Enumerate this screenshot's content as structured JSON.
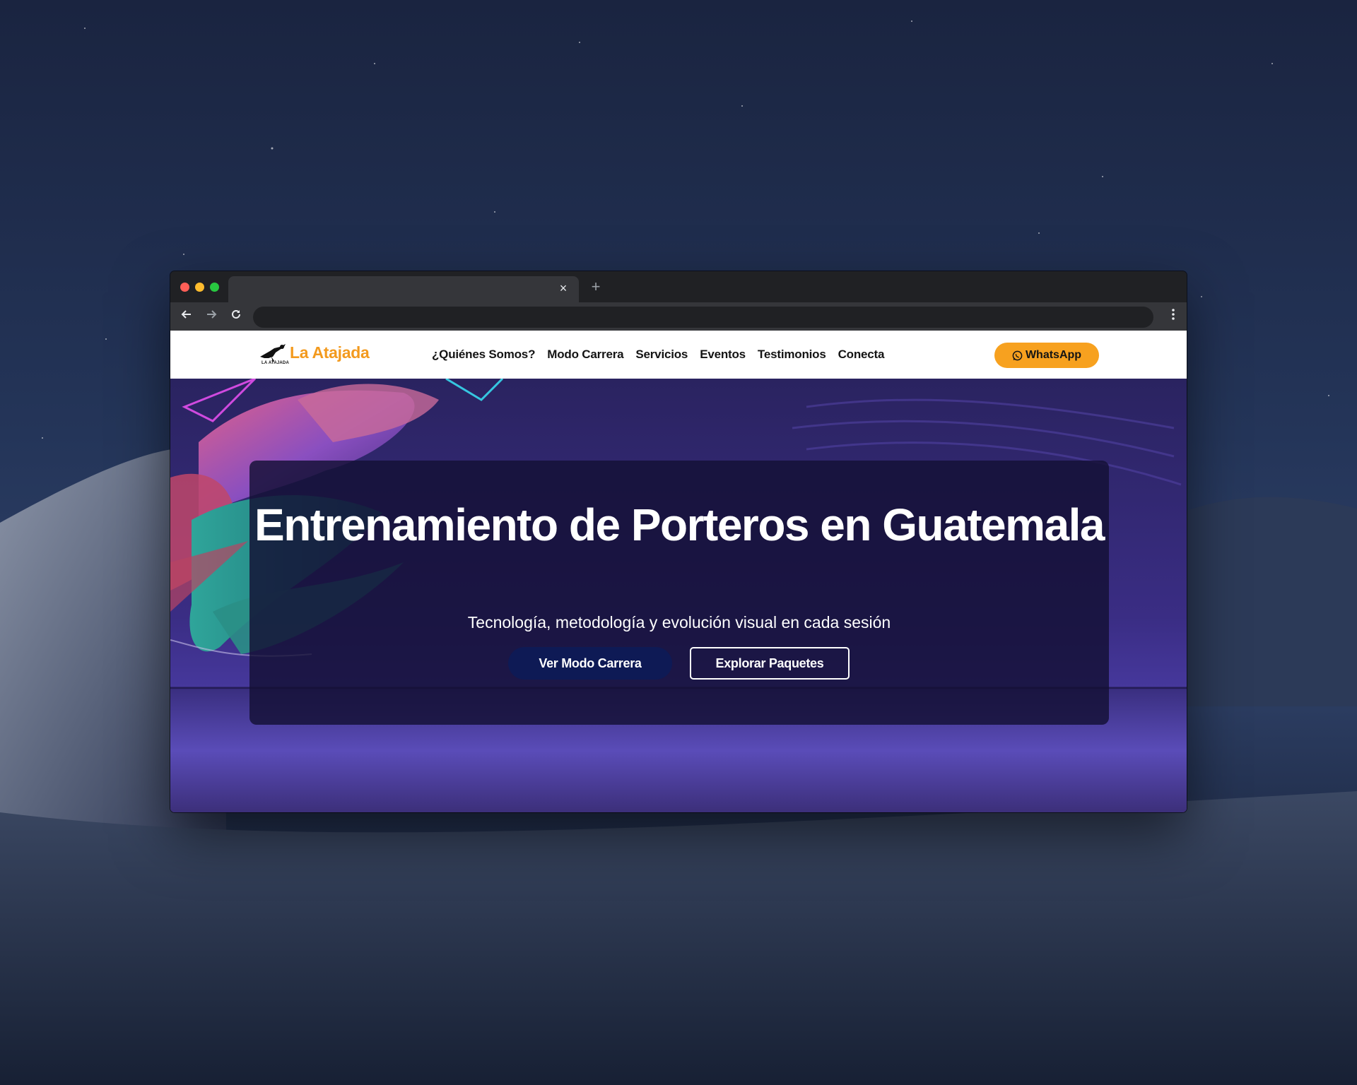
{
  "browser": {
    "tab_close": "×",
    "tab_new": "+",
    "address_value": ""
  },
  "site": {
    "logo": {
      "name": "La Atajada",
      "sub": "LA ATAJADA"
    },
    "nav": [
      {
        "label": "¿Quiénes Somos?"
      },
      {
        "label": "Modo Carrera"
      },
      {
        "label": "Servicios"
      },
      {
        "label": "Eventos"
      },
      {
        "label": "Testimonios"
      },
      {
        "label": "Conecta"
      }
    ],
    "whatsapp_label": "WhatsApp"
  },
  "hero": {
    "title": "Entrenamiento de Porteros en Guatemala",
    "subtitle": "Tecnología, metodología y evolución visual en cada sesión",
    "primary_cta": "Ver Modo Carrera",
    "secondary_cta": "Explorar Paquetes"
  },
  "icons": {
    "back": "arrow-left-icon",
    "forward": "arrow-right-icon",
    "reload": "reload-icon",
    "menu": "kebab-menu-icon",
    "whatsapp": "whatsapp-icon",
    "logo": "goalkeeper-logo-icon"
  },
  "colors": {
    "brand_orange": "#f39a1e",
    "whatsapp_button": "#f7a11f",
    "primary_button": "#0e1a55",
    "hero_card": "#141034",
    "hero_bg": "#3a2d84"
  }
}
